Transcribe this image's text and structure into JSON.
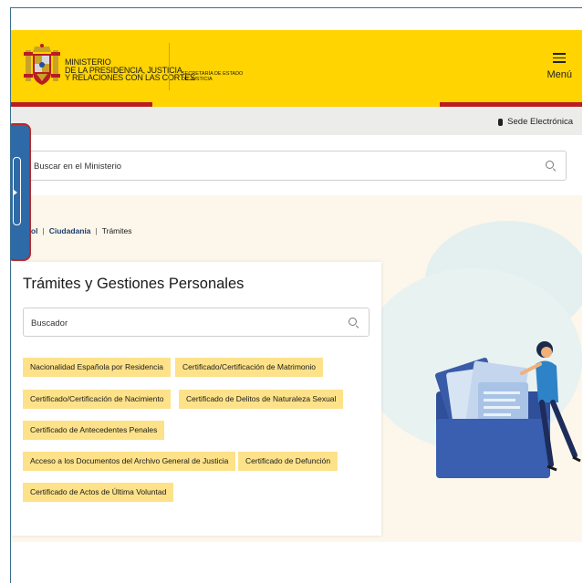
{
  "header": {
    "ministry_lines": [
      "MINISTERIO",
      "DE LA PRESIDENCIA, JUSTICIA",
      "Y RELACIONES CON LAS CORTES"
    ],
    "secretaria_lines": [
      "SECRETARÍA DE ESTADO",
      "DE JUSTICIA"
    ],
    "menu_label": "Menú",
    "menu_icon": "hamburger-icon",
    "crest_icon": "coat-of-arms-icon"
  },
  "sede_bar": {
    "label": "Sede Electrónica",
    "icon": "phone-icon"
  },
  "site_search": {
    "placeholder": "Buscar en el Ministerio",
    "icon": "search-icon"
  },
  "breadcrumb": {
    "items": [
      "eñol",
      "Ciudadanía",
      "Trámites"
    ]
  },
  "card": {
    "title": "Trámites y Gestiones Personales",
    "search_placeholder": "Buscador",
    "tags": [
      "Nacionalidad Española por Residencia",
      "Certificado/Certificación de Matrimonio",
      "Certificado/Certificación de Nacimiento",
      "Certificado de Delitos de Naturaleza Sexual",
      "Certificado de Antecedentes Penales",
      "Acceso a los Documentos del Archivo General de Justicia",
      "Certificado de Defunción",
      "Certificado de Actos de Última Voluntad"
    ]
  },
  "colors": {
    "header_yellow": "#ffd400",
    "accent_red": "#b91d22",
    "tag_yellow": "#fde28a",
    "link_blue": "#1f3f6e",
    "side_tab_blue": "#2e6aa8"
  }
}
